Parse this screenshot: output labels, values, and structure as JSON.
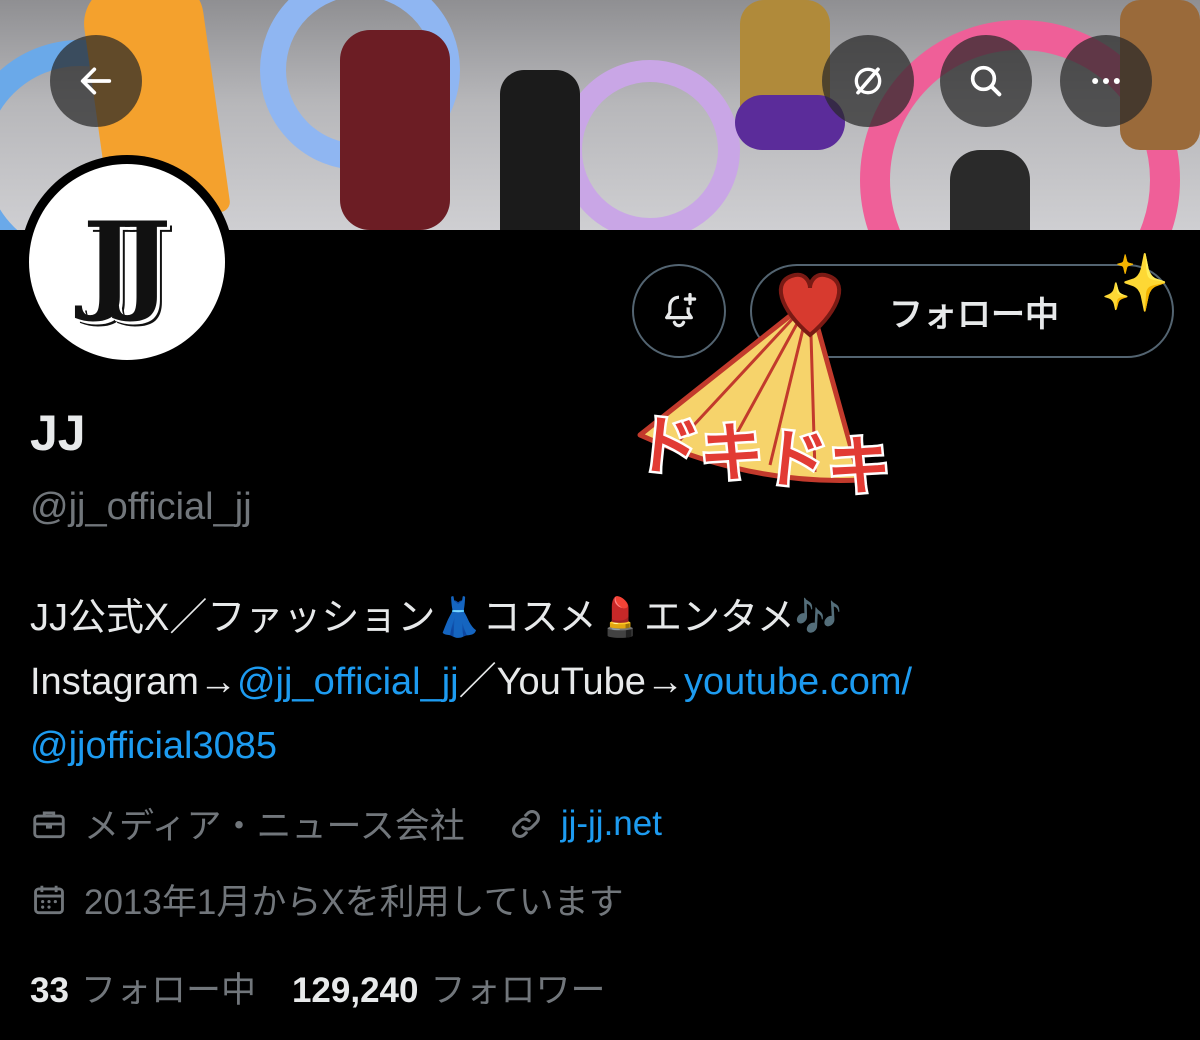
{
  "profile": {
    "avatar_text": "JJ",
    "name": "JJ",
    "handle": "@jj_official_jj",
    "follow_button_label": "フォロー中",
    "bio": {
      "line1": "JJ公式X／ファッション👗コスメ💄エンタメ🎶",
      "line2_prefix": "Instagram→",
      "instagram_link": "@jj_official_jj",
      "line2_mid": "／YouTube→",
      "youtube_link_part1": "youtube.com/",
      "youtube_link_part2": "@jjofficial3085"
    },
    "category": "メディア・ニュース会社",
    "website": "jj-jj.net",
    "joined": "2013年1月からXを利用しています",
    "following_count": "33",
    "following_label": "フォロー中",
    "followers_count": "129,240",
    "followers_label": "フォロワー"
  },
  "sticker": {
    "text": "ドキドキ",
    "sparkle": "✨"
  },
  "icons": {
    "back": "back-arrow-icon",
    "grok": "grok-icon",
    "search": "search-icon",
    "more": "more-icon",
    "notify": "bell-plus-icon",
    "category": "briefcase-icon",
    "website": "link-icon",
    "joined": "calendar-icon"
  },
  "colors": {
    "background": "#000000",
    "primary_text": "#e7e9ea",
    "secondary_text": "#71767b",
    "link": "#1d9bf0",
    "border": "#536471"
  }
}
